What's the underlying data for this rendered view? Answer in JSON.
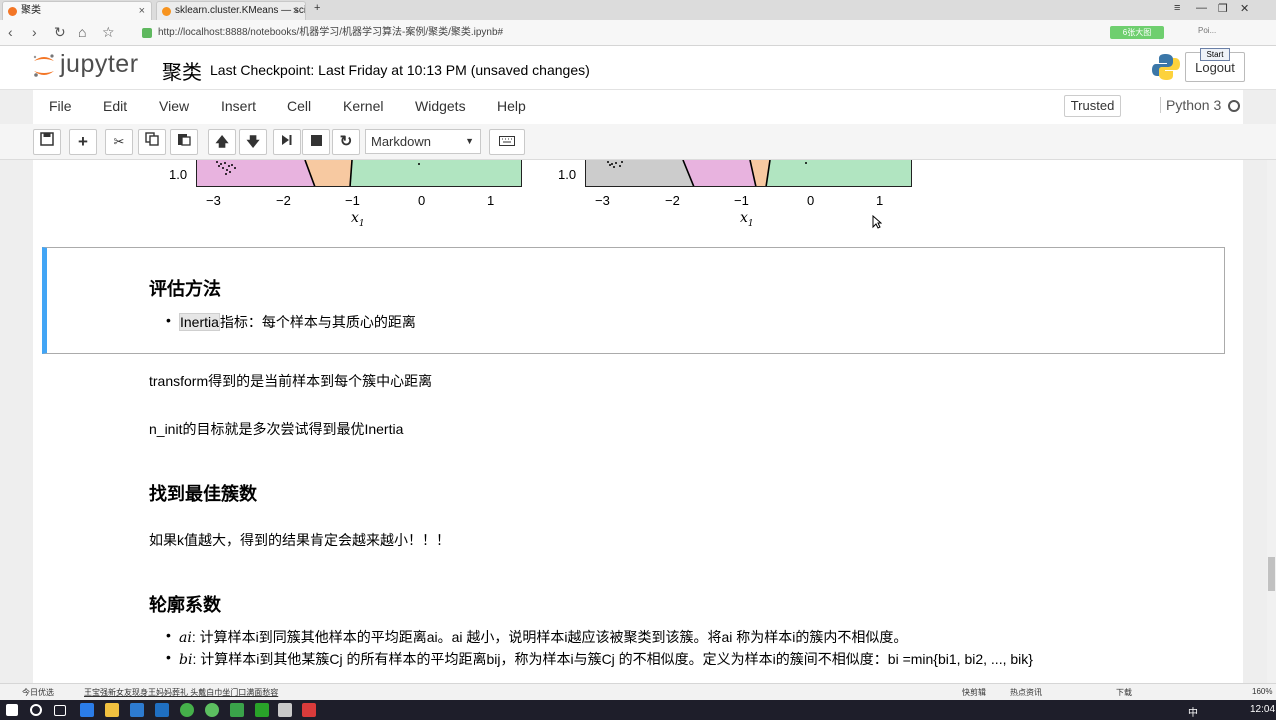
{
  "browser": {
    "tabs": [
      "聚类",
      "sklearn.cluster.KMeans — sci"
    ],
    "url": "http://localhost:8888/notebooks/机器学习/机器学习算法-案例/聚类/聚类.ipynb#",
    "ext_badge": "6张大图",
    "search_placeholder": "Poi..."
  },
  "header": {
    "logo": "jupyter",
    "notebook_name": "聚类",
    "checkpoint": "Last Checkpoint: Last Friday at 10:13 PM (unsaved changes)",
    "logout": "Logout",
    "start": "Start"
  },
  "menubar": {
    "items": [
      "File",
      "Edit",
      "View",
      "Insert",
      "Cell",
      "Kernel",
      "Widgets",
      "Help"
    ],
    "trusted": "Trusted",
    "kernel": "Python 3"
  },
  "toolbar": {
    "buttons": [
      "save-icon",
      "plus-icon",
      "cut-icon",
      "copy-icon",
      "paste-icon",
      "arrow-up-icon",
      "arrow-down-icon",
      "skip-forward-icon",
      "stop-icon",
      "refresh-icon"
    ],
    "cell_type": "Markdown",
    "keyboard_icon": "keyboard-icon"
  },
  "plots": {
    "y_tick": "1.0",
    "x_ticks": [
      "−3",
      "−2",
      "−1",
      "0",
      "1"
    ],
    "xlabel": "x",
    "xlabel_sub": "1",
    "region_colors": {
      "pink": "#e8b3df",
      "orange": "#f7c9a1",
      "green": "#b1e5c1",
      "grey": "#cccccc"
    }
  },
  "cells": {
    "eval_heading": "评估方法",
    "eval_bullet_code": "Inertia",
    "eval_bullet_text": "指标：每个样本与其质心的距离",
    "p_transform": "transform得到的是当前样本到每个簇中心距离",
    "p_ninit": "n_init的目标就是多次尝试得到最优Inertia",
    "best_heading": "找到最佳簇数",
    "p_k": "如果k值越大，得到的结果肯定会越来越小！！！",
    "sil_heading": "轮廓系数",
    "ai_sym": "ai",
    "ai_text": ": 计算样本i到同簇其他样本的平均距离ai。ai 越小，说明样本i越应该被聚类到该簇。将ai 称为样本i的簇内不相似度。",
    "bi_sym": "bi",
    "bi_text": ": 计算样本i到其他某簇Cj 的所有样本的平均距离bij，称为样本i与簇Cj 的不相似度。定义为样本i的簇间不相似度：bi =min{bi1, bi2, ..., bik}"
  },
  "statusbar": {
    "left": "今日优选",
    "news": "王宝强新女友现身王妈妈葬礼 头戴白巾坐门口满面愁容",
    "items": [
      "快剪辑",
      "热点资讯",
      "下载",
      "160%"
    ]
  },
  "taskbar": {
    "time": "12:04",
    "lang": "中"
  }
}
